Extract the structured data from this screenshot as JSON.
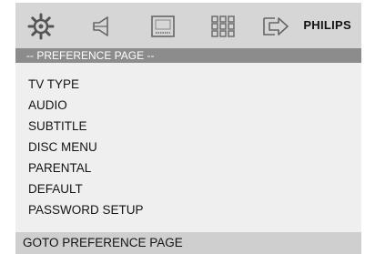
{
  "toolbar": {
    "icons": [
      "gear-icon",
      "speaker-icon",
      "subtitle-screen-icon",
      "grid-icon",
      "exit-arrow-icon"
    ],
    "brand": "PHILIPS"
  },
  "page_header": "-- PREFERENCE PAGE --",
  "menu": {
    "items": [
      "TV TYPE",
      "AUDIO",
      "SUBTITLE",
      "DISC MENU",
      "PARENTAL",
      "DEFAULT",
      "PASSWORD SETUP"
    ]
  },
  "status_bar": "GOTO PREFERENCE PAGE",
  "colors": {
    "toolbar_bg": "#d6d6d6",
    "header_bg": "#8c8c8c",
    "menu_bg": "#efefef",
    "status_bg": "#cfcfcf"
  }
}
